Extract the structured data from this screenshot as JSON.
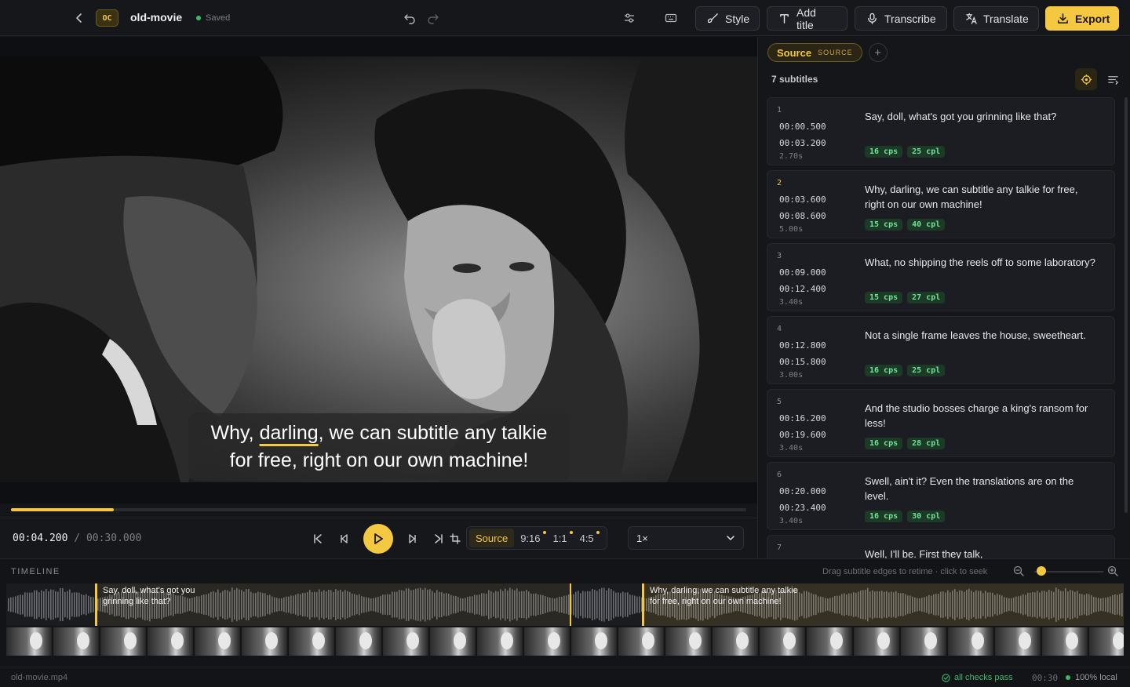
{
  "header": {
    "logo_text": "OC",
    "project_name": "old-movie",
    "save_status": "Saved",
    "buttons": {
      "style": "Style",
      "add_title": "Add title",
      "transcribe": "Transcribe",
      "translate": "Translate",
      "export": "Export"
    }
  },
  "video": {
    "caption_before": "Why, ",
    "caption_highlight": "darling",
    "caption_after": ", we can subtitle any talkie",
    "caption_line2": "for free, right on our own machine!",
    "progress_fraction": 0.14
  },
  "transport": {
    "current_time": "00:04.200",
    "separator": "/",
    "duration": "00:30.000",
    "aspects": [
      "Source",
      "9:16",
      "1:1",
      "4:5"
    ],
    "speed": "1×"
  },
  "panel": {
    "tab_source_label": "Source",
    "tab_source_badge": "SOURCE",
    "tab_add": "+",
    "count_label": "7 subtitles",
    "subtitles": [
      {
        "index": "1",
        "start": "00:00.500",
        "end": "00:03.200",
        "duration": "2.70s",
        "text": "Say, doll, what's got you grinning like that?",
        "cps": "16 cps",
        "cpl": "25 cpl"
      },
      {
        "index": "2",
        "start": "00:03.600",
        "end": "00:08.600",
        "duration": "5.00s",
        "text": "Why, darling, we can subtitle any talkie for free, right on our own machine!",
        "cps": "15 cps",
        "cpl": "40 cpl"
      },
      {
        "index": "3",
        "start": "00:09.000",
        "end": "00:12.400",
        "duration": "3.40s",
        "text": "What, no shipping the reels off to some laboratory?",
        "cps": "15 cps",
        "cpl": "27 cpl"
      },
      {
        "index": "4",
        "start": "00:12.800",
        "end": "00:15.800",
        "duration": "3.00s",
        "text": "Not a single frame leaves the house, sweetheart.",
        "cps": "16 cps",
        "cpl": "25 cpl"
      },
      {
        "index": "5",
        "start": "00:16.200",
        "end": "00:19.600",
        "duration": "3.40s",
        "text": "And the studio bosses charge a king's ransom for less!",
        "cps": "16 cps",
        "cpl": "28 cpl"
      },
      {
        "index": "6",
        "start": "00:20.000",
        "end": "00:23.400",
        "duration": "3.40s",
        "text": "Swell, ain't it? Even the translations are on the level.",
        "cps": "16 cps",
        "cpl": "30 cpl"
      },
      {
        "index": "7",
        "start": "",
        "end": "",
        "duration": "",
        "text": "Well, I'll be. First they talk,",
        "cps": "",
        "cpl": ""
      }
    ]
  },
  "timeline": {
    "label": "TIMELINE",
    "hint": "Drag subtitle edges to retime · click to seek",
    "segments": [
      {
        "line1": "Say, doll, what's got you",
        "line2": "grinning like that?"
      },
      {
        "line1": "Why, darling, we can subtitle any talkie",
        "line2": "for free, right on our own machine!"
      }
    ]
  },
  "status": {
    "file": "old-movie.mp4",
    "checks": "all checks pass",
    "length": "00:30",
    "local": "100% local"
  },
  "colors": {
    "accent": "#f5c842",
    "ok": "#3fb96a",
    "background": "#15161a"
  }
}
